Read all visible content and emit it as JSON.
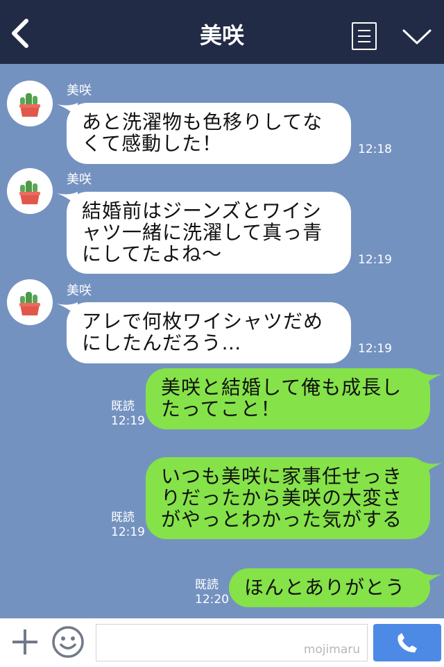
{
  "header": {
    "title": "美咲"
  },
  "contact": {
    "name": "美咲"
  },
  "messages": [
    {
      "side": "in",
      "text": "あと洗濯物も色移りしてな\nくて感動した！",
      "time": "12:18"
    },
    {
      "side": "in",
      "text": "結婚前はジーンズとワイシ\nャツ一緒に洗濯して真っ青\nにしてたよね〜",
      "time": "12:19"
    },
    {
      "side": "in",
      "text": "アレで何枚ワイシャツだめ\nにしたんだろう…",
      "time": "12:19"
    },
    {
      "side": "out",
      "text": "美咲と結婚して俺も成長し\nたってこと！",
      "read": "既読",
      "time": "12:19"
    },
    {
      "side": "out",
      "text": "いつも美咲に家事任せっき\nりだったから美咲の大変さ\nがやっとわかった気がする",
      "read": "既読",
      "time": "12:19"
    },
    {
      "side": "out",
      "text": "ほんとありがとう",
      "read": "既読",
      "time": "12:20"
    }
  ],
  "footer": {
    "watermark": "mojimaru"
  },
  "icons": {
    "back": "back-arrow-icon",
    "menu": "menu-list-icon",
    "collapse": "chevron-down-icon",
    "add": "plus-icon",
    "emoji": "smiley-icon",
    "call": "phone-icon",
    "avatar": "cactus-icon"
  },
  "colors": {
    "header_bg": "#222b45",
    "chat_bg": "#7492c0",
    "incoming_bubble": "#ffffff",
    "outgoing_bubble": "#85e249",
    "call_button": "#4d8ae6"
  }
}
